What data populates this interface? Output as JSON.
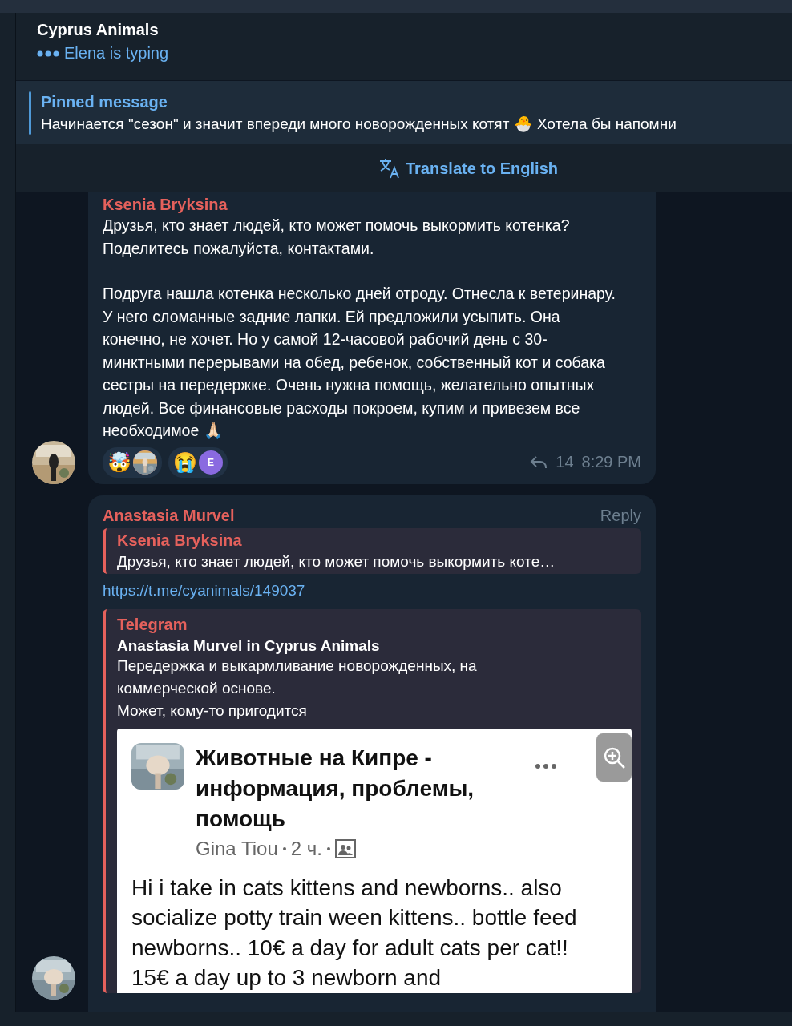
{
  "header": {
    "title": "Cyprus Animals",
    "status": "Elena is typing"
  },
  "pinned": {
    "label": "Pinned message",
    "text": "Начинается \"сезон\" и значит впереди много новорожденных котят 🐣  Хотела бы напомни"
  },
  "translate": {
    "label": "Translate to English"
  },
  "messages": [
    {
      "kind": "post",
      "sender": "Ksenia Bryksina",
      "paragraphs": [
        "Друзья, кто знает людей, кто может помочь выкормить котенка? Поделитесь пожалуйста, контактами.",
        "Подруга нашла котенка несколько дней отроду. Отнесла к ветеринару. У него сломанные задние лапки. Ей предложили усыпить. Она конечно, не хочет. Но у самой 12-часовой рабочий день с 30-минктными перерывами на обед, ребенок, собственный кот и собака сестры на передержке. Очень нужна помощь, желательно опытных людей. Все финансовые расходы покроем, купим и привезем все необходимое 🙏🏻"
      ],
      "reactions": [
        {
          "emoji": "🤯"
        },
        {
          "emoji": "😭",
          "avatar": {
            "kind": "letter",
            "letter": "E"
          }
        }
      ],
      "replies": "14",
      "time": "8:29 PM"
    },
    {
      "kind": "reply",
      "sender": "Anastasia Murvel",
      "action": "Reply",
      "quote": {
        "sender": "Ksenia Bryksina",
        "text": "Друзья, кто знает людей, кто может помочь выкормить коте…"
      },
      "link": "https://t.me/cyanimals/149037",
      "preview": {
        "site": "Telegram",
        "title": "Anastasia Murvel in Cyprus Animals",
        "description": [
          "Передержка и выкармливание новорожденных, на коммерческой основе.",
          "Может, кому-то пригодится"
        ],
        "screenshot": {
          "group_title": "Животные на Кипре - информация, проблемы, помощь",
          "author": "Gina Tiou",
          "age": "2 ч.",
          "body": "Hi i take in cats kittens and newborns.. also socialize potty train ween kittens.. bottle feed newborns.. 10€ a day for adult cats per cat!! 15€ a day up to 3 newborn and"
        }
      }
    }
  ]
}
